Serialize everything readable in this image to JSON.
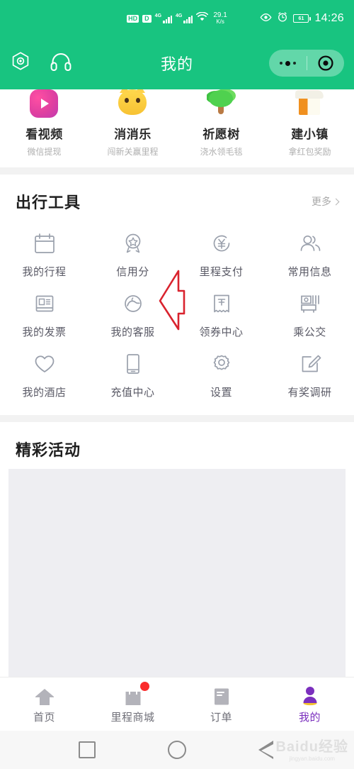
{
  "status_bar": {
    "hd_label": "HD",
    "data_label": "D",
    "sim1_sup": "4G",
    "sim2_sup": "4G",
    "net_speed_value": "29.1",
    "net_speed_unit": "K/s",
    "battery_percent": "61",
    "time": "14:26",
    "icons": [
      "hd-icon",
      "data-icon",
      "signal-icon",
      "signal-icon",
      "wifi-icon",
      "eye-icon",
      "alarm-icon",
      "battery-icon"
    ]
  },
  "header": {
    "title": "我的",
    "brand_green": "#18c480",
    "left_icons": [
      "camera-hex-icon",
      "headphone-icon"
    ],
    "capsule_icons": [
      "more-dots-icon",
      "target-circle-icon"
    ]
  },
  "top_apps": [
    {
      "name": "看视频",
      "sub": "微信提现",
      "icon": "video-play-icon"
    },
    {
      "name": "消消乐",
      "sub": "闯新关赢里程",
      "icon": "cat-face-icon"
    },
    {
      "name": "祈愿树",
      "sub": "浇水领毛毯",
      "icon": "tree-icon"
    },
    {
      "name": "建小镇",
      "sub": "拿红包奖励",
      "icon": "house-icon"
    }
  ],
  "tools_section": {
    "title": "出行工具",
    "more_label": "更多",
    "items": [
      {
        "label": "我的行程",
        "icon": "calendar-icon"
      },
      {
        "label": "信用分",
        "icon": "medal-star-icon"
      },
      {
        "label": "里程支付",
        "icon": "yen-circle-icon"
      },
      {
        "label": "常用信息",
        "icon": "people-icon"
      },
      {
        "label": "我的发票",
        "icon": "invoice-icon"
      },
      {
        "label": "我的客服",
        "icon": "customer-service-icon"
      },
      {
        "label": "领券中心",
        "icon": "coupon-icon"
      },
      {
        "label": "乘公交",
        "icon": "bus-icon"
      },
      {
        "label": "我的酒店",
        "icon": "heart-icon"
      },
      {
        "label": "充值中心",
        "icon": "phone-icon"
      },
      {
        "label": "设置",
        "icon": "gear-icon"
      },
      {
        "label": "有奖调研",
        "icon": "edit-pencil-icon"
      }
    ]
  },
  "activity_section": {
    "title": "精彩活动"
  },
  "annotation": {
    "type": "arrow-left",
    "color": "#d9232e",
    "points_to": "我的客服"
  },
  "tab_bar": {
    "active_color": "#7b2fbe",
    "inactive_color": "#6f6f78",
    "items": [
      {
        "label": "首页",
        "icon": "home-icon",
        "active": false,
        "badge": false
      },
      {
        "label": "里程商城",
        "icon": "shop-bag-icon",
        "active": false,
        "badge": true
      },
      {
        "label": "订单",
        "icon": "order-book-icon",
        "active": false,
        "badge": false
      },
      {
        "label": "我的",
        "icon": "person-icon",
        "active": true,
        "badge": false
      }
    ]
  },
  "android_nav": {
    "buttons": [
      "recent-square-icon",
      "home-circle-icon",
      "back-triangle-icon"
    ]
  },
  "watermark": {
    "text": "Baidu经验",
    "sub": "jingyan.baidu.com"
  }
}
